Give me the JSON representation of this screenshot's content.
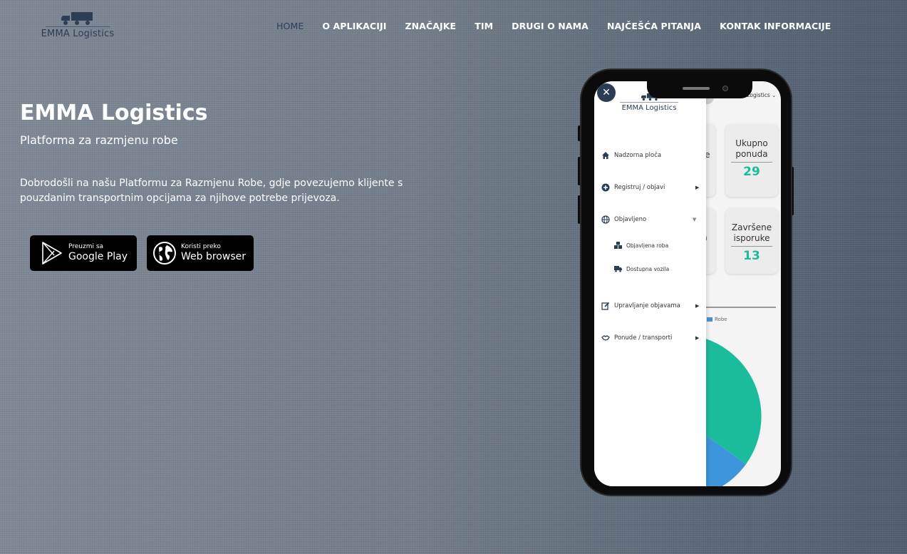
{
  "brand": {
    "name": "EMMA Logistics"
  },
  "nav": {
    "items": [
      {
        "label": "HOME",
        "active": true
      },
      {
        "label": "O APLIKACIJI"
      },
      {
        "label": "ZNAČAJKE"
      },
      {
        "label": "TIM"
      },
      {
        "label": "DRUGI O NAMA"
      },
      {
        "label": "NAJČEŠĆA PITANJA"
      },
      {
        "label": "KONTAK INFORMACIJE"
      }
    ]
  },
  "hero": {
    "title": "EMMA Logistics",
    "subtitle": "Platforma za razmjenu robe",
    "description": "Dobrodošli na našu Platformu za Razmjenu Robe, gdje povezujemo klijente s pouzdanim transportnim opcijama za njihove potrebe prijevoza."
  },
  "buttons": {
    "play": {
      "small": "Preuzmi sa",
      "big": "Google Play",
      "icon": "google-play-icon"
    },
    "web": {
      "small": "Koristi preko",
      "big": "Web browser",
      "icon": "globe-icon"
    }
  },
  "phone": {
    "close_label": "✕",
    "logo_text": "EMMA Logistics",
    "user_label": "Emma Logistics",
    "menu": {
      "dashboard": "Nadzorna ploča",
      "register": "Registruj / objavi",
      "published": "Objavljeno",
      "published_goods": "Objavljena roba",
      "available_vehicles": "Dostupna vozila",
      "manage_posts": "Upravljanje objavama",
      "offers_transports": "Ponude / transporti"
    },
    "cards": {
      "card1_partial": "ne",
      "card1_dash": "-",
      "card2_label_1": "Ukupno",
      "card2_label_2": "ponuda",
      "card2_value": "29",
      "card3_partial": "a",
      "card3_dash": "-",
      "card4_label_1": "Završene",
      "card4_label_2": "isporuke",
      "card4_value": "13"
    },
    "legend": "Robe",
    "colors": {
      "teal": "#1abc9c",
      "blue": "#3d96dc",
      "navy": "#2b3d55"
    }
  }
}
